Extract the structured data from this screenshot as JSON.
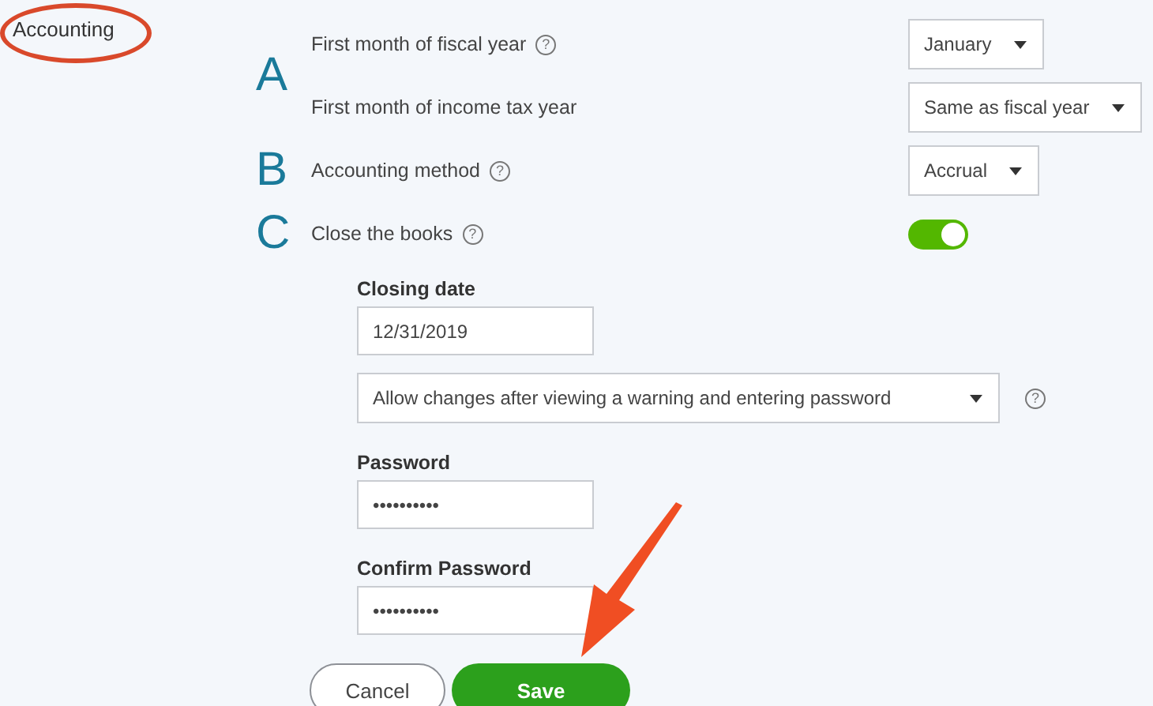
{
  "sidebar": {
    "section": "Accounting"
  },
  "settings": [
    {
      "marker": "A",
      "label": "First month of fiscal year",
      "help": "?",
      "kind": "select",
      "value": "January"
    },
    {
      "label": "First month of income tax year",
      "kind": "select",
      "value": "Same as fiscal year"
    },
    {
      "marker": "B",
      "label": "Accounting method",
      "help": "?",
      "kind": "select",
      "value": "Accrual"
    },
    {
      "marker": "C",
      "label": "Close the books",
      "help": "?",
      "kind": "toggle",
      "on": true
    }
  ],
  "close_books": {
    "closing_date": {
      "label": "Closing date",
      "value": "12/31/2019"
    },
    "restriction": {
      "value": "Allow changes after viewing a warning and entering password",
      "help": "?"
    },
    "password": {
      "label": "Password",
      "value": "••••••••••"
    },
    "confirm_password": {
      "label": "Confirm Password",
      "value": "••••••••••"
    }
  },
  "buttons": {
    "cancel": "Cancel",
    "save": "Save"
  }
}
